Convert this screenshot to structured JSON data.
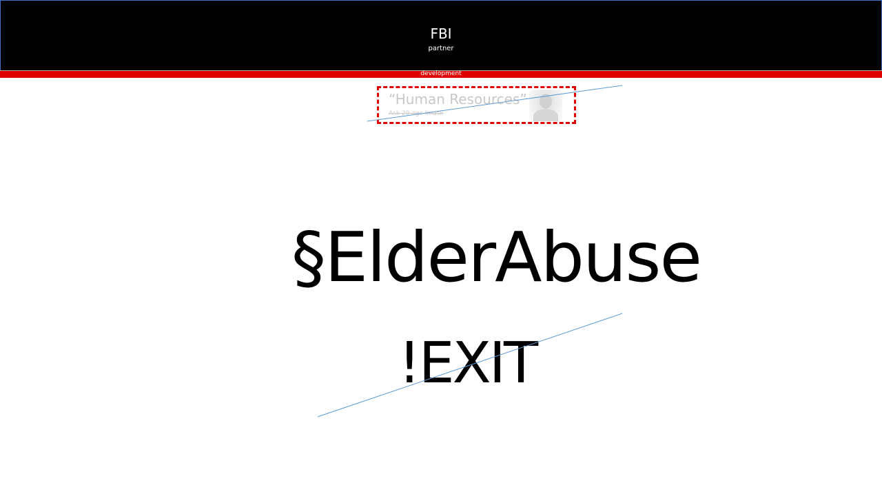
{
  "header": {
    "title": "FBI",
    "subtitle": "partner"
  },
  "strip": {
    "label": "development"
  },
  "quote": {
    "text": "“Human Resources”",
    "attribution": "Ask 20 age Imask",
    "portrait_icon": "portrait-photo"
  },
  "main": {
    "title": "§ElderAbuse",
    "exit": "!EXIT"
  },
  "colors": {
    "banner": "#000000",
    "strip": "#e00000",
    "dashed_border": "#e00000",
    "connector_line": "#5b9bd5"
  }
}
